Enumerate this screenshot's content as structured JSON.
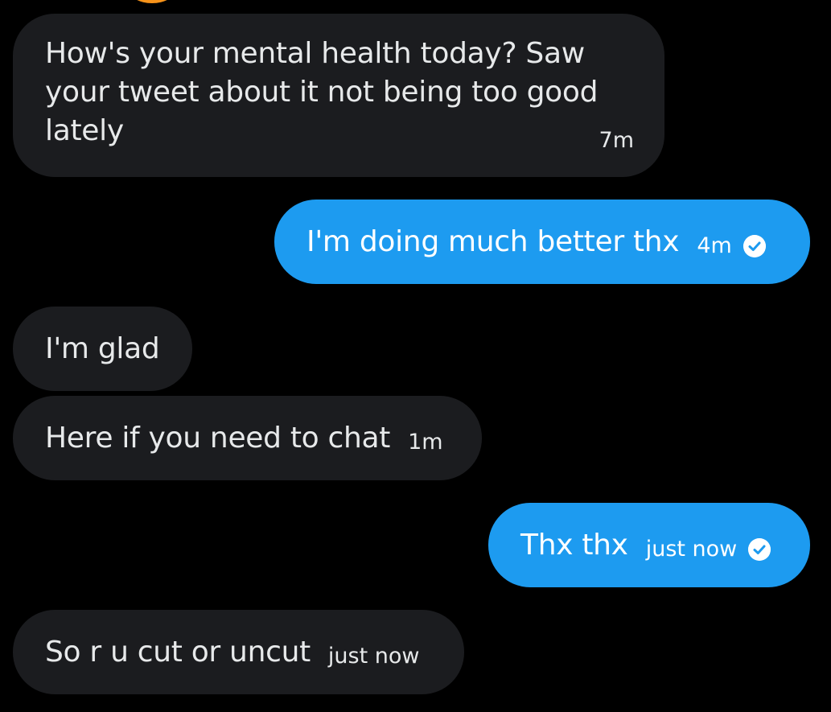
{
  "colors": {
    "background": "#000000",
    "incoming_bubble": "#1b1c1f",
    "outgoing_bubble": "#1d9bf0",
    "text": "#e7e9ea"
  },
  "messages": [
    {
      "direction": "incoming",
      "text": "How's your mental health today? Saw your tweet about it not being too good lately",
      "time": "7m"
    },
    {
      "direction": "outgoing",
      "text": "I'm doing much better thx",
      "time": "4m",
      "status_icon": "sent-check-icon"
    },
    {
      "direction": "incoming",
      "text": "I'm glad",
      "time": ""
    },
    {
      "direction": "incoming",
      "text": "Here if you need to chat",
      "time": "1m"
    },
    {
      "direction": "outgoing",
      "text": "Thx thx",
      "time": "just now",
      "status_icon": "sent-check-icon"
    },
    {
      "direction": "incoming",
      "text": "So r u cut or uncut",
      "time": "just now"
    }
  ]
}
